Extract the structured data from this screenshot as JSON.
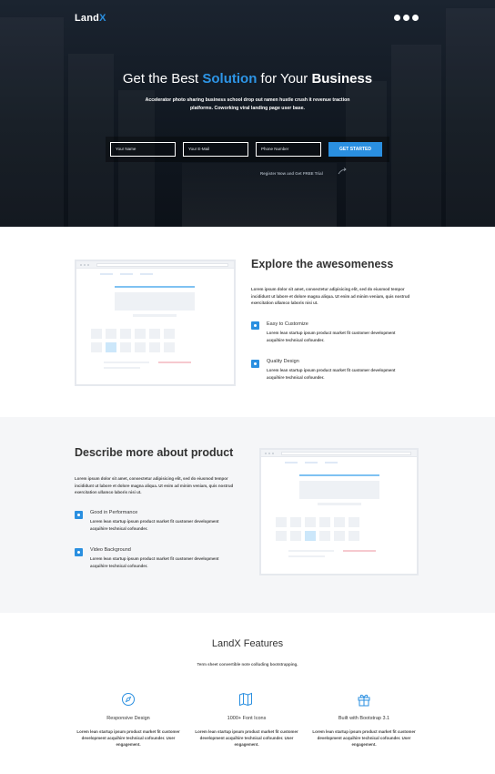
{
  "brand": {
    "name_main": "Land",
    "name_accent": "X"
  },
  "colors": {
    "accent": "#2a8fe0",
    "hero_bg": "#111821",
    "alt_bg": "#f5f6f8"
  },
  "social_icons": [
    "facebook-icon",
    "twitter-icon",
    "linkedin-icon"
  ],
  "hero": {
    "title_part1": "Get the Best ",
    "title_accent": "Solution",
    "title_part2": " for Your ",
    "title_bold": "Business",
    "subtitle": "Accelerator photo sharing business school drop out ramen hustle crush it revenue traction platforms. Coworking viral landing page user base.",
    "form": {
      "name_placeholder": "Your Name",
      "email_placeholder": "Your E-Mail",
      "phone_placeholder": "Phone Number",
      "submit_label": "GET STARTED"
    },
    "register_note": "Register Now and Get FREE Trial"
  },
  "explore": {
    "title": "Explore the awesomeness",
    "body": "Lorem ipsum dolor sit amet, consectetur adipisicing elit, sed do eiusmod tempor incididunt ut labore et dolore magna aliqua. Ut enim ad minim veniam, quis nostrud exercitation ullamco laboris nisi ut.",
    "features": [
      {
        "icon": "settings-icon",
        "title": "Easy to Customize",
        "desc": "Lorem lean startup ipsum product market fit customer development acquihire technical cofounder."
      },
      {
        "icon": "star-icon",
        "title": "Quality Design",
        "desc": "Lorem lean startup ipsum product market fit customer development acquihire technical cofounder."
      }
    ]
  },
  "describe": {
    "title": "Describe more about product",
    "body": "Lorem ipsum dolor sit amet, consectetur adipisicing elit, sed do eiusmod tempor incididunt ut labore et dolore magna aliqua. Ut enim ad minim veniam, quis nostrud exercitation ullamco laboris nisi ut.",
    "features": [
      {
        "icon": "speedometer-icon",
        "title": "Good in Performance",
        "desc": "Lorem lean startup ipsum product market fit customer development acquihire technical cofounder."
      },
      {
        "icon": "video-icon",
        "title": "Video Background",
        "desc": "Lorem lean startup ipsum product market fit customer development acquihire technical cofounder."
      }
    ]
  },
  "features": {
    "title": "LandX Features",
    "subtitle": "Term sheet convertible note colluding bootstrapping.",
    "columns": [
      {
        "icon": "compass-icon",
        "title": "Responsive Design",
        "desc": "Lorem lean startup ipsum product market fit customer development acquihire technical cofounder. User engagement."
      },
      {
        "icon": "map-icon",
        "title": "1000+ Font Icons",
        "desc": "Lorem lean startup ipsum product market fit customer development acquihire technical cofounder. User engagement."
      },
      {
        "icon": "gift-icon",
        "title": "Built with Bootstrap 3.1",
        "desc": "Lorem lean startup ipsum product market fit customer development acquihire technical cofounder. User engagement."
      }
    ]
  }
}
